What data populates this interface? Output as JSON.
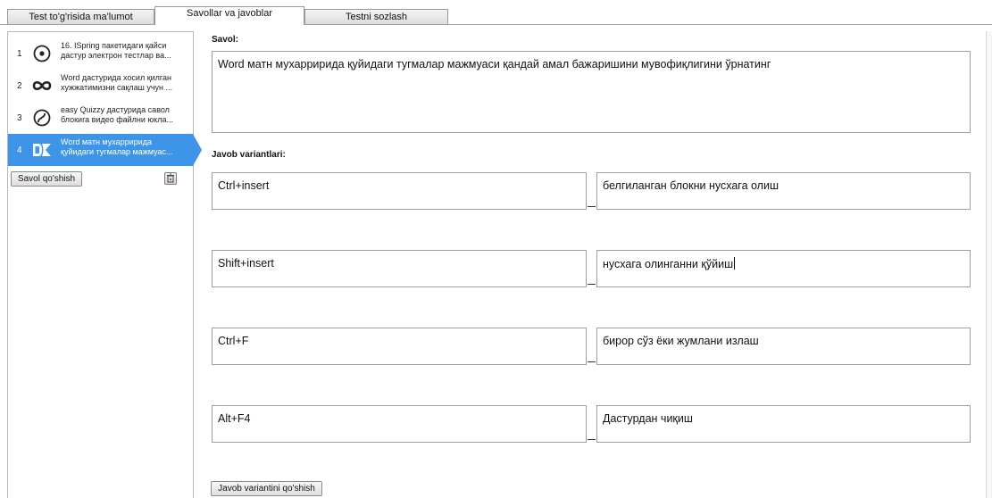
{
  "tabs": [
    {
      "label": "Test to'g'risida ma'lumot"
    },
    {
      "label": "Savollar va javoblar"
    },
    {
      "label": "Testni sozlash"
    }
  ],
  "questions": [
    {
      "num": "1",
      "icon": "single-choice-icon",
      "line1": "16. ISpring пакетидаги қайси",
      "line2": "дастур электрон тестлар ва..."
    },
    {
      "num": "2",
      "icon": "matching-icon",
      "line1": "Word дастурида хосил қилган",
      "line2": "хужжатимизни сақлаш учун ..."
    },
    {
      "num": "3",
      "icon": "sequence-icon",
      "line1": "easy Quizzy дастурида савол",
      "line2": "блокига видео файлни юкла..."
    },
    {
      "num": "4",
      "icon": "drag-drop-icon",
      "line1": "Word матн мухарририда",
      "line2": "қуйидаги тугмалар мажмуас..."
    }
  ],
  "left_buttons": {
    "add_question": "Savol qo'shish"
  },
  "question_label": "Savol:",
  "question_text": "Word матн мухарририда қуйидаги тугмалар мажмуаси  қандай амал бажаришини мувофиқлигини ўрнатинг",
  "answers_label": "Javob variantlari:",
  "pairs": [
    {
      "left": "Ctrl+insert",
      "right": "белгиланган блокни нусхага олиш"
    },
    {
      "left": "Shift+insert",
      "right": "нусхага олинганни қўйиш"
    },
    {
      "left": "Ctrl+F",
      "right": "бирор сўз ёки жумлани излаш"
    },
    {
      "left": "Alt+F4",
      "right": "Дастурдан чиқиш"
    }
  ],
  "add_answer_button": "Javob variantini qo'shish",
  "colors": {
    "selection": "#3d94e8",
    "border": "#9e9e9e"
  }
}
